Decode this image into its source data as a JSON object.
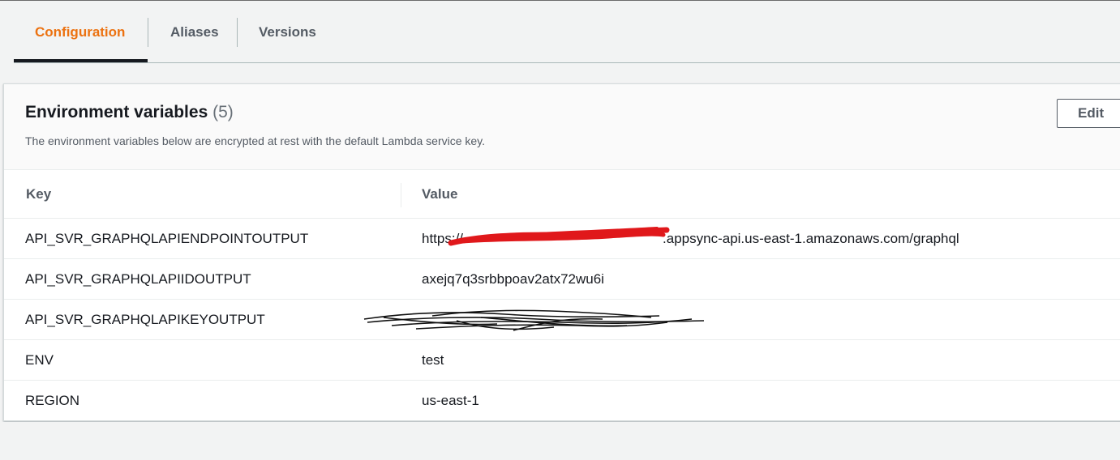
{
  "tabs": [
    {
      "label": "Configuration",
      "active": true
    },
    {
      "label": "Aliases",
      "active": false
    },
    {
      "label": "Versions",
      "active": false
    }
  ],
  "panel": {
    "title": "Environment variables",
    "count": "(5)",
    "description": "The environment variables below are encrypted at rest with the default Lambda service key.",
    "edit_label": "Edit"
  },
  "table": {
    "headers": {
      "key": "Key",
      "value": "Value"
    },
    "rows": [
      {
        "key": "API_SVR_GRAPHQLAPIENDPOINTOUTPUT",
        "value": "https://",
        "value_suffix": ".appsync-api.us-east-1.amazonaws.com/graphql"
      },
      {
        "key": "API_SVR_GRAPHQLAPIIDOUTPUT",
        "value": "axejq7q3srbbpoav2atx72wu6i"
      },
      {
        "key": "API_SVR_GRAPHQLAPIKEYOUTPUT",
        "value": ""
      },
      {
        "key": "ENV",
        "value": "test"
      },
      {
        "key": "REGION",
        "value": "us-east-1"
      }
    ]
  },
  "colors": {
    "accent": "#ec7211",
    "redact_red": "#e0181b",
    "redact_black": "#111111"
  }
}
